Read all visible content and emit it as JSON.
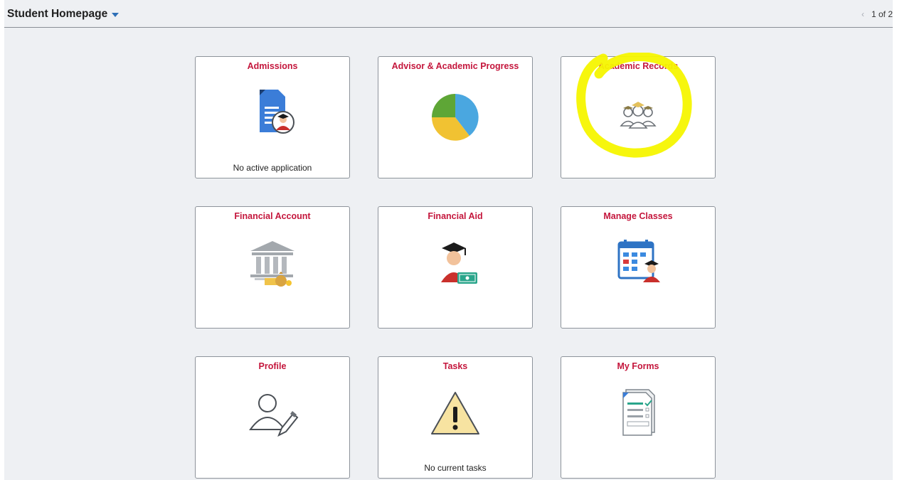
{
  "header": {
    "title": "Student Homepage",
    "pager": {
      "prev_symbol": "‹",
      "text": "1 of 2"
    }
  },
  "tiles": [
    {
      "title": "Admissions",
      "status": "No active application",
      "icon": "application-document-icon"
    },
    {
      "title": "Advisor & Academic Progress",
      "status": "",
      "icon": "pie-chart-icon"
    },
    {
      "title": "Academic Records",
      "status": "",
      "icon": "graduates-group-icon"
    },
    {
      "title": "Financial Account",
      "status": "",
      "icon": "bank-money-icon"
    },
    {
      "title": "Financial Aid",
      "status": "",
      "icon": "graduate-with-cash-icon"
    },
    {
      "title": "Manage Classes",
      "status": "",
      "icon": "calendar-graduate-icon"
    },
    {
      "title": "Profile",
      "status": "",
      "icon": "profile-edit-icon"
    },
    {
      "title": "Tasks",
      "status": "No current tasks",
      "icon": "warning-icon"
    },
    {
      "title": "My Forms",
      "status": "",
      "icon": "forms-checklist-icon"
    }
  ],
  "colors": {
    "tile_title": "#c4163c",
    "background": "#eef0f3",
    "highlight": "#f5f500",
    "accent": "#2e6fb7"
  }
}
